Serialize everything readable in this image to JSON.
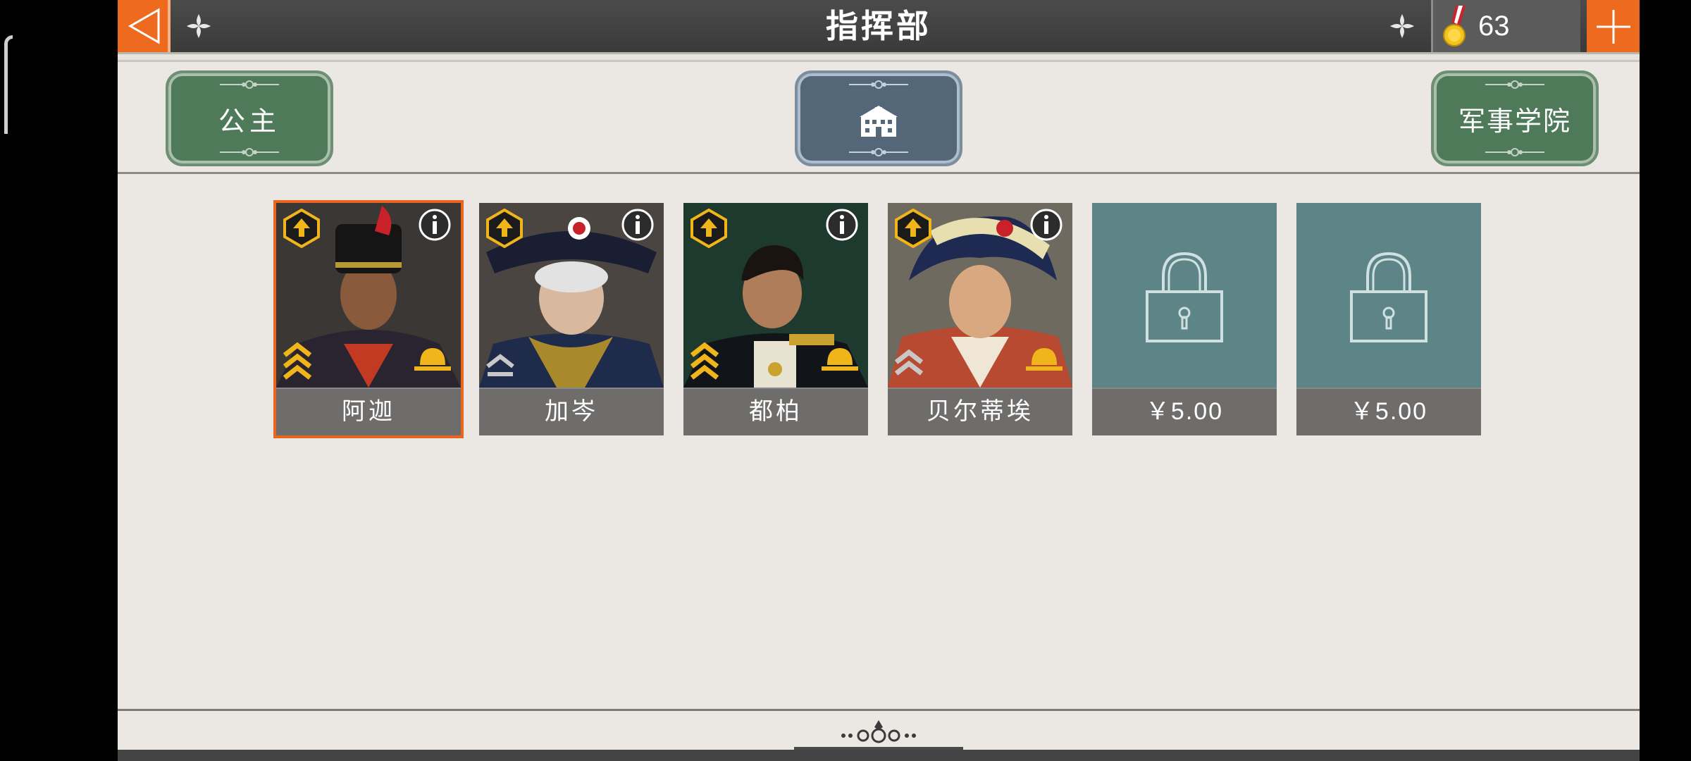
{
  "header": {
    "title": "指挥部",
    "currency_value": "63"
  },
  "categories": [
    {
      "label": "公主",
      "icon": "none"
    },
    {
      "label": "",
      "icon": "building-icon"
    },
    {
      "label": "军事学院",
      "icon": "none"
    }
  ],
  "generals": [
    {
      "name": "阿迦",
      "selected": true,
      "rank_color": "gold",
      "hat_color": "gold"
    },
    {
      "name": "加岑",
      "selected": false,
      "rank_color": "silver",
      "hat_color": "none"
    },
    {
      "name": "都柏",
      "selected": false,
      "rank_color": "gold",
      "hat_color": "gold"
    },
    {
      "name": "贝尔蒂埃",
      "selected": false,
      "rank_color": "silver",
      "hat_color": "gold"
    }
  ],
  "locked_slots": [
    {
      "price": "￥5.00"
    },
    {
      "price": "￥5.00"
    }
  ],
  "colors": {
    "accent_orange": "#ee6a1e",
    "badge_gold": "#f1b51c",
    "button_green": "#4f7a5a",
    "button_blue": "#536779",
    "locked_teal": "#5d8487"
  }
}
